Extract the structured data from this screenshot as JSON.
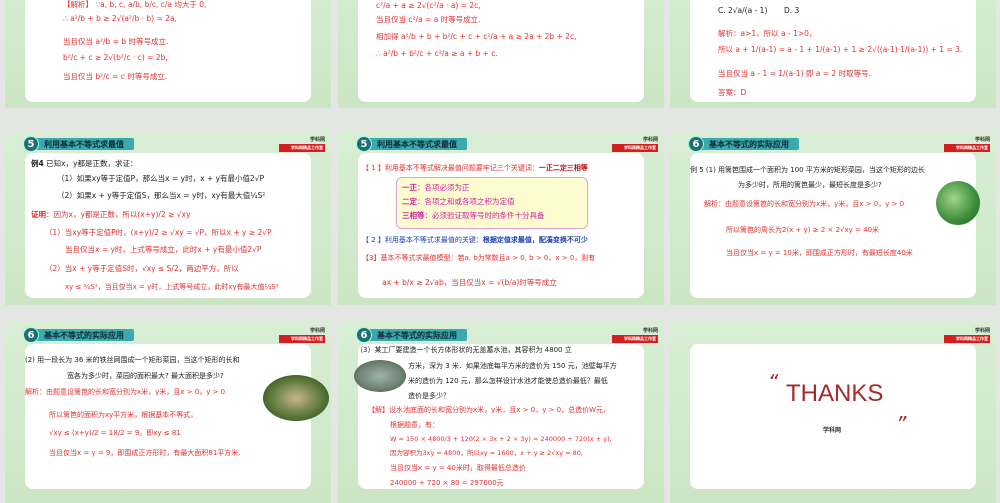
{
  "logo": {
    "name": "学科网",
    "tag": "学科网精品工作室"
  },
  "slides": [
    {
      "lines": [
        "【解析】  ∵a, b, c, a/b, b/c, c/a 均大于 0,",
        "∴ a²/b + b ≥ 2√(a²/b · b) = 2a,",
        "当且仅当 a²/b = b 时等号成立.",
        "b²/c + c ≥ 2√(b²/c · c) = 2b,",
        "当且仅当 b²/c = c 时等号成立."
      ]
    },
    {
      "lines": [
        "c²/a + a ≥ 2√(c²/a · a) = 2c,",
        "当且仅当 c²/a = a 时等号成立.",
        "相加得 a²/b + b + b²/c + c + c²/a + a ≥ 2a + 2b + 2c,",
        "∴ a²/b + b²/c + c²/a ≥ a + b + c."
      ]
    },
    {
      "options": [
        "C. 2√a/(a - 1)",
        "D. 3"
      ],
      "lines": [
        "解析：a>1，所以 a - 1>0，",
        "所以 a + 1/(a-1) = a - 1 + 1/(a-1) + 1 ≥ 2√((a-1)·1/(a-1)) + 1 = 3.",
        "当且仅当 a - 1 = 1/(a-1) 即 a = 2 时取等号.",
        "答案：D"
      ]
    },
    {
      "num": "5",
      "title": "利用基本不等式求最值",
      "example": "例4",
      "q": [
        "已知x，y都是正数，求证：",
        "（1）如果xy等于定值P，那么当x = y时，x + y有最小值2√P",
        "（2）如果x + y等于定值S，那么当x = y时，xy有最大值¼S²"
      ],
      "proof_label": "证明",
      "lines": [
        "：因为x，y都是正数，所以(x+y)/2 ≥ √xy",
        "（1）当xy等于定值P时，(x+y)/2 ≥ √xy = √P，所以x + y ≥ 2√P",
        "当且仅当x = y时，上式等号成立，此时x + y有最小值2√P",
        "（2）当x + y等于定值S时，√xy ≤ S/2，两边平方，所以",
        "xy ≤ ¼S²，当且仅当x = y时，上式等号成立，此时xy有最大值¼S²"
      ]
    },
    {
      "num": "5",
      "title": "利用基本不等式求最值",
      "p1": "【 1 】利用基本不等式解决最值问题要牢记三个关键词：",
      "p1b": "一正二定三相等",
      "box": [
        {
          "k": "一正",
          "v": "：各项必须为正"
        },
        {
          "k": "二定",
          "v": "：各项之和或各项之积为定值"
        },
        {
          "k": "三相等",
          "v": "：必须验证取等号时的条件十分具备"
        }
      ],
      "p2": "【 2 】利用基本不等式求最值的关键：",
      "p2b": "根据定值求最值，配凑变换不可少",
      "p3": "【3】基本不等式求最值模型：若a, b为常数且a > 0, b > 0，x > 0，则有",
      "p4": "ax + b/x ≥ 2√ab，当且仅当x = √(b/a)时等号成立"
    },
    {
      "num": "6",
      "title": "基本不等式的实际应用",
      "q": [
        "例 5 (1) 用篱笆围成一个面积为 100 平方米的矩形菜园，当这个矩形的边长",
        "为多少时，所用的篱笆最少，最短长度是多少?"
      ],
      "lines": [
        "解析：由题意设篱笆的长和宽分别为x米，y米，且x > 0，y > 0",
        "所以篱笆的周长为2(x + y) ≥ 2 × 2√xy = 40米",
        "当且仅当x = y = 10米，即围成正方形时，有最短长度40米"
      ]
    },
    {
      "num": "6",
      "title": "基本不等式的实际应用",
      "q": [
        "(2) 用一段长为 36 米的铁丝网围成一个矩形菜园，当这个矩形的长和",
        "宽各为多少时，菜园的面积最大? 最大面积是多少?"
      ],
      "lines": [
        "解析：由题意设篱笆的长和宽分别为x米，y米，且x > 0，y > 0",
        "所以篱笆的面积为xy平方米，根据基本不等式，",
        "√xy ≤ (x+y)/2 = 18/2 = 9，即xy ≤ 81",
        "当且仅当x = y = 9，即围成正方形时，有最大面积81平方米."
      ]
    },
    {
      "num": "6",
      "title": "基本不等式的实际应用",
      "q": [
        "（3）某工厂要建造一个长方体形状的无盖蓄水池，其容积为 4800 立",
        "方米，深为 3 米．如果池底每平方米的造价为 150 元，池壁每平方",
        "米的造价为 120 元，那么怎样设计水池才能使总造价最低？最低",
        "造价是多少？"
      ],
      "lines": [
        "【解】设水池底面的长和宽分别为x米，y米，且x > 0，y > 0，总造价W元，",
        "根据题意，有：",
        "W = 150 × 4800/3 + 120(2 × 3x + 2 × 3y) = 240000 + 720(x + y),",
        "因为容积为3xy = 4800，所以xy = 1600，x + y ≥ 2√xy = 80,",
        "当且仅当x = y = 40米时，取得最低总造价",
        "240000 + 720 × 80 = 297600元"
      ]
    },
    {
      "thanks": "THANKS",
      "open_quote": "“",
      "close_quote": "”"
    }
  ]
}
